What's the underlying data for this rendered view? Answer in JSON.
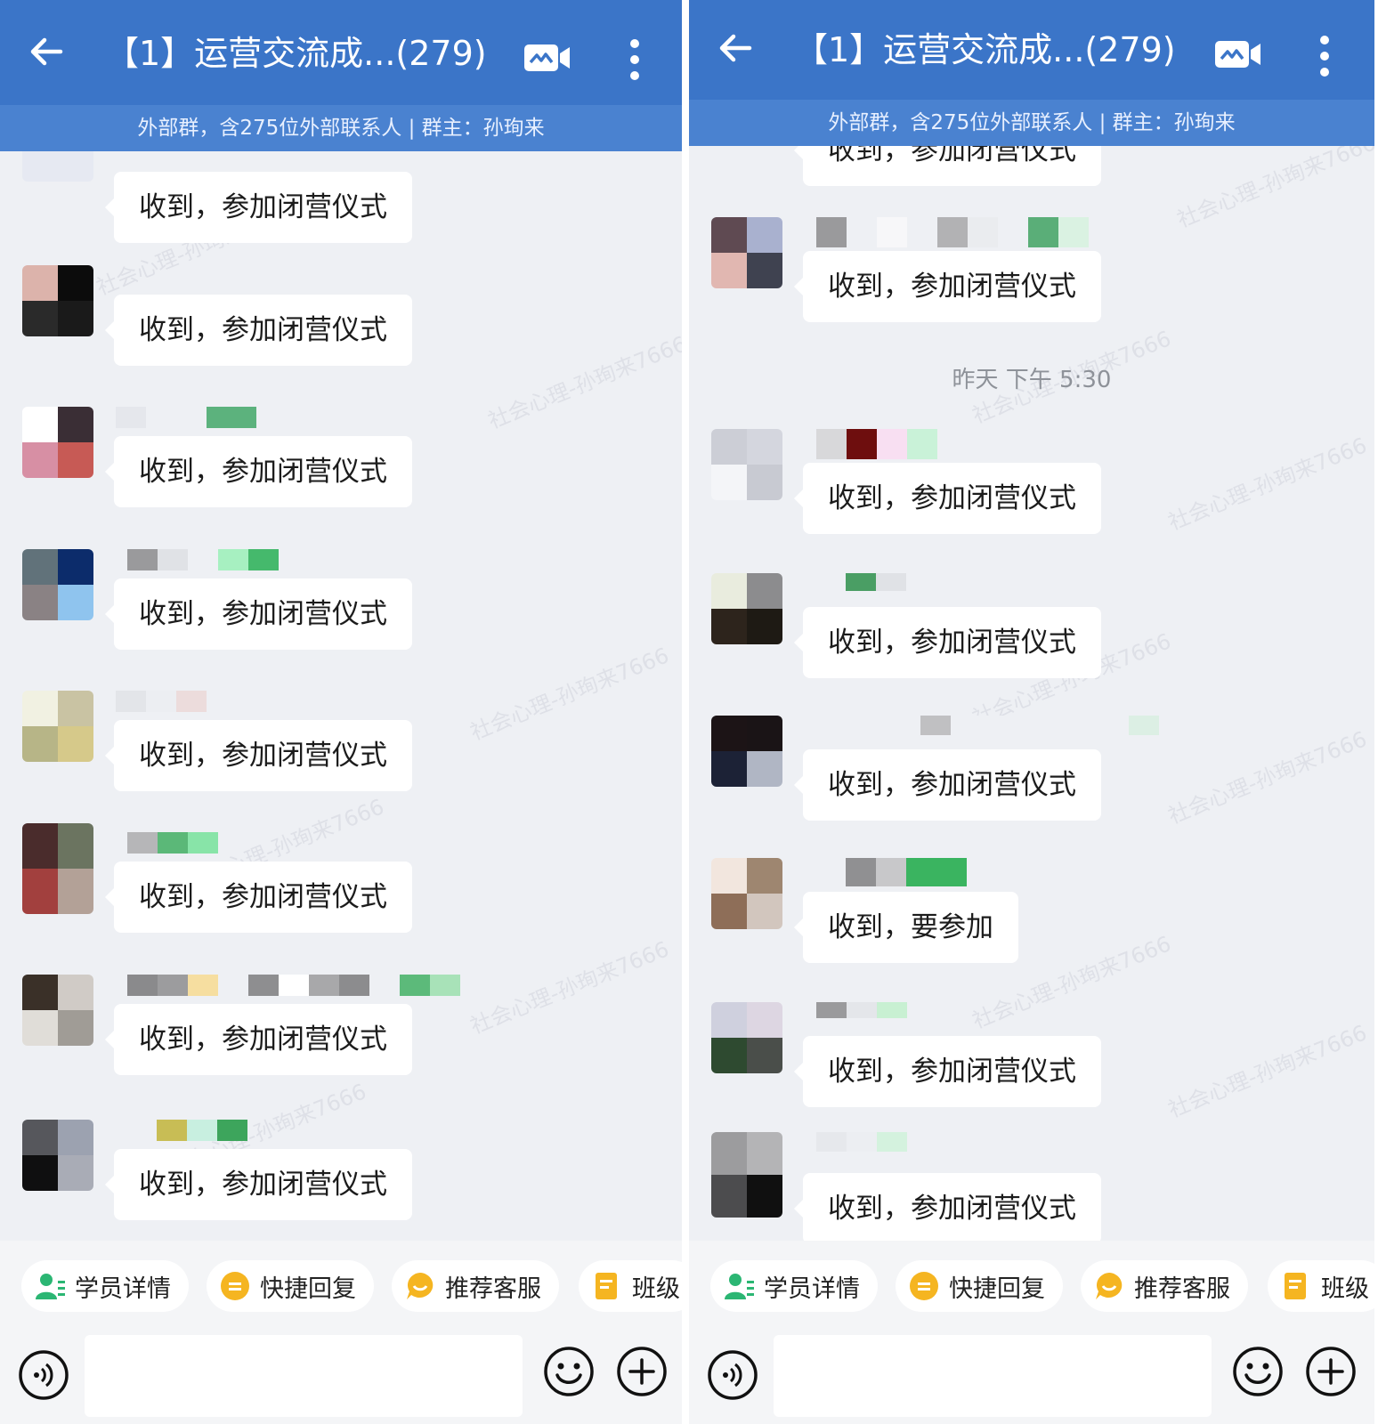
{
  "header": {
    "title": "【1】运营交流成...(279)",
    "subtitle": "外部群，含275位外部联系人 | 群主：孙珣来"
  },
  "watermark_text": "社会心理-孙珣来7666",
  "left_panel": {
    "messages": [
      {
        "text": "收到，参加闭营仪式"
      },
      {
        "text": "收到，参加闭营仪式"
      },
      {
        "text": "收到，参加闭营仪式"
      },
      {
        "text": "收到，参加闭营仪式"
      },
      {
        "text": "收到，参加闭营仪式"
      },
      {
        "text": "收到，参加闭营仪式"
      },
      {
        "text": "收到，参加闭营仪式"
      },
      {
        "text": "收到，参加闭营仪式"
      }
    ]
  },
  "right_panel": {
    "partial_top_message": "收到，参加闭营仪式",
    "messages_before_time": [
      {
        "text": "收到，参加闭营仪式"
      }
    ],
    "timestamp": "昨天  下午 5:30",
    "messages_after_time": [
      {
        "text": "收到，参加闭营仪式"
      },
      {
        "text": "收到，参加闭营仪式"
      },
      {
        "text": "收到，参加闭营仪式"
      },
      {
        "text": "收到，要参加"
      },
      {
        "text": "收到，参加闭营仪式"
      },
      {
        "text": "收到，参加闭营仪式"
      }
    ]
  },
  "action_chips": [
    {
      "label": "学员详情",
      "icon": "user-detail-icon",
      "color": "#2bb673"
    },
    {
      "label": "快捷回复",
      "icon": "quick-reply-icon",
      "color": "#f5b521"
    },
    {
      "label": "推荐客服",
      "icon": "recommend-service-icon",
      "color": "#f5b521"
    },
    {
      "label": "班级",
      "icon": "class-icon",
      "color": "#f5b521"
    }
  ],
  "input": {
    "value": "",
    "placeholder": ""
  },
  "colors": {
    "header": "#3b75c8",
    "subheader": "#4a82d0",
    "background": "#eef0f4",
    "bubble": "#ffffff"
  }
}
